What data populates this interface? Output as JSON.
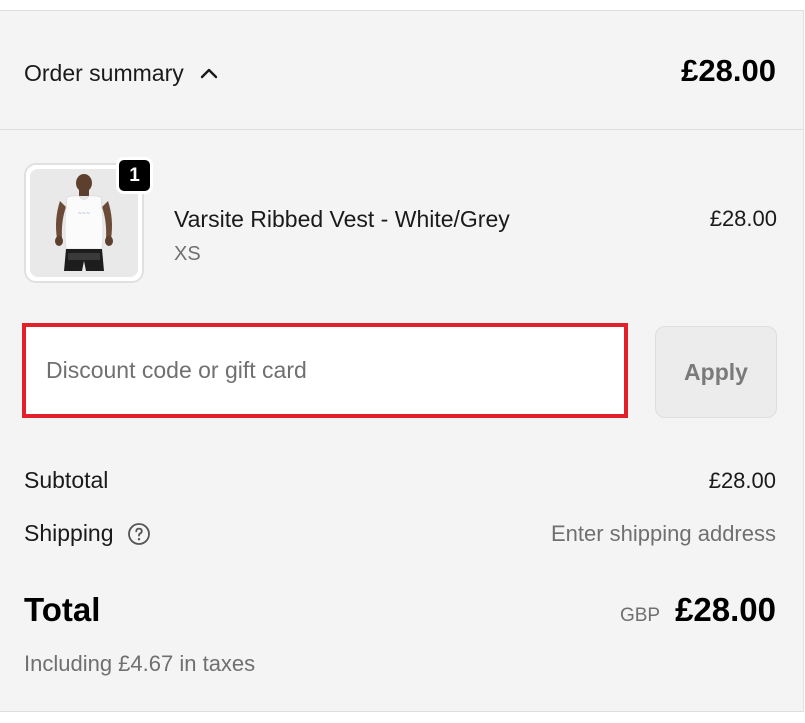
{
  "summary": {
    "toggle_label": "Order summary",
    "toggle_icon": "chevron-up-icon",
    "header_total": "£28.00"
  },
  "line_item": {
    "quantity": "1",
    "name": "Varsite Ribbed Vest - White/Grey",
    "variant": "XS",
    "price": "£28.00"
  },
  "discount": {
    "placeholder": "Discount code or gift card",
    "value": "",
    "apply_label": "Apply",
    "highlight_color": "#e3202a"
  },
  "totals": {
    "subtotal_label": "Subtotal",
    "subtotal_value": "£28.00",
    "shipping_label": "Shipping",
    "shipping_help_icon": "question-circle-icon",
    "shipping_value": "Enter shipping address",
    "total_label": "Total",
    "currency": "GBP",
    "total_value": "£28.00",
    "tax_note": "Including £4.67 in taxes"
  }
}
